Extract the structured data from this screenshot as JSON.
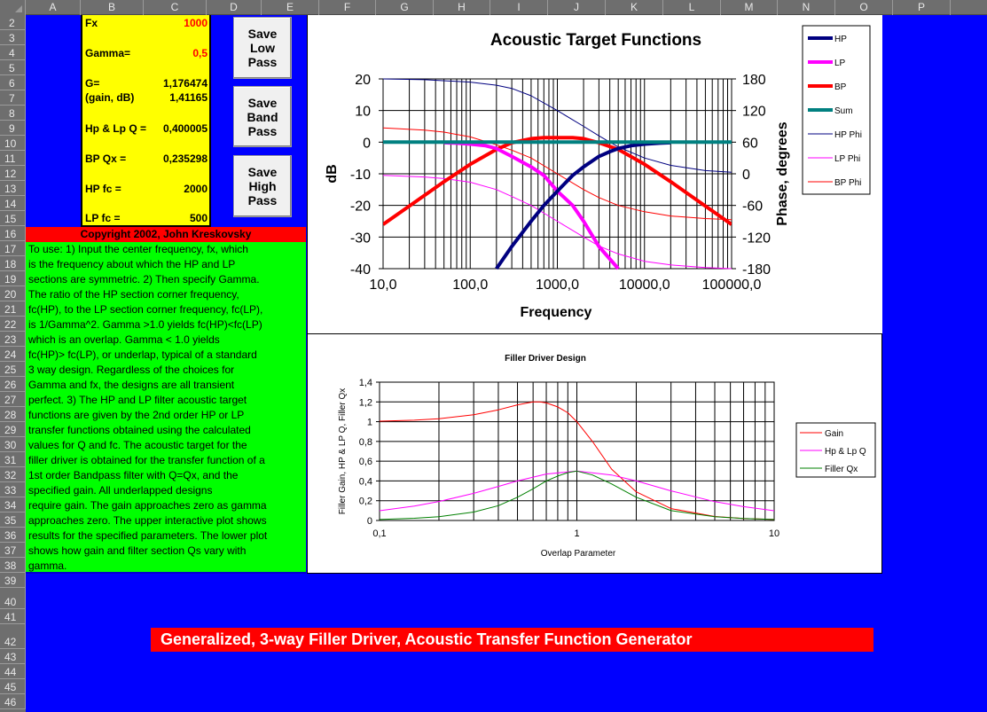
{
  "sheet": {
    "columns": [
      "A",
      "B",
      "C",
      "D",
      "E",
      "F",
      "G",
      "H",
      "I",
      "J",
      "K",
      "L",
      "M",
      "N",
      "O",
      "P"
    ],
    "rows": [
      "2",
      "3",
      "4",
      "5",
      "6",
      "7",
      "8",
      "9",
      "10",
      "11",
      "12",
      "13",
      "14",
      "15",
      "16",
      "17",
      "18",
      "19",
      "20",
      "21",
      "22",
      "23",
      "24",
      "25",
      "26",
      "27",
      "28",
      "29",
      "30",
      "31",
      "32",
      "33",
      "34",
      "35",
      "36",
      "37",
      "38",
      "39",
      "40",
      "41",
      "42",
      "43",
      "44",
      "45",
      "46"
    ]
  },
  "params": {
    "fx_label": "Fx",
    "fx_value": "1000",
    "gamma_label": "Gamma=",
    "gamma_value": "0,5",
    "g_label": "G=",
    "g_value": "1,176474",
    "gain_db_label": "(gain, dB)",
    "gain_db_value": "1,41165",
    "hplp_q_label": "Hp & Lp Q =",
    "hplp_q_value": "0,400005",
    "bp_qx_label": "BP Qx =",
    "bp_qx_value": "0,235298",
    "hp_fc_label": "HP fc =",
    "hp_fc_value": "2000",
    "lp_fc_label": "LP fc =",
    "lp_fc_value": "500"
  },
  "buttons": {
    "save_low_pass": "Save\nLow\nPass",
    "save_band_pass": "Save\nBand\nPass",
    "save_high_pass": "Save\nHigh\nPass"
  },
  "copyright": "Copyright 2002, John Kreskovsky",
  "instructions": [
    "To use: 1) Input the center frequency, fx, which",
    "is the frequency about which the HP and LP",
    "sections are symmetric. 2) Then specify Gamma.",
    "The ratio of the HP section corner frequency,",
    "fc(HP), to the LP section corner frequency, fc(LP),",
    "is 1/Gamma^2. Gamma >1.0 yields fc(HP)<fc(LP)",
    "which is an overlap. Gamma < 1.0 yields",
    "fc(HP)> fc(LP), or underlap, typical of a standard",
    "3 way design. Regardless of the choices for",
    "Gamma and fx, the designs are all transient",
    "perfect. 3) The HP and LP filter acoustic target",
    "functions are given by the 2nd order HP or LP",
    "transfer functions obtained using the calculated",
    "values for Q and fc. The acoustic target for the",
    "filler driver is obtained for the transfer function of a",
    "1st order Bandpass filter with Q=Qx, and the",
    "specified gain.  All underlapped designs",
    "require gain. The gain approaches zero as gamma",
    "approaches zero. The upper interactive plot shows",
    "results for the specified parameters. The lower plot",
    "shows how gain and filter section Qs vary with",
    "gamma."
  ],
  "banner": "Generalized, 3-way Filler Driver, Acoustic Transfer Function Generator",
  "chart_data": [
    {
      "type": "line",
      "title": "Acoustic Target Functions",
      "xlabel": "Frequency",
      "ylabel": "dB",
      "y2label": "Phase, degrees",
      "xscale": "log",
      "xlim": [
        10,
        100000
      ],
      "ylim": [
        -40,
        20
      ],
      "y2lim": [
        -180,
        180
      ],
      "xticks": [
        "10,0",
        "100,0",
        "1000,0",
        "10000,0",
        "100000,0"
      ],
      "yticks": [
        "20",
        "10",
        "0",
        "-10",
        "-20",
        "-30",
        "-40"
      ],
      "y2ticks": [
        "180",
        "120",
        "60",
        "0",
        "-60",
        "-120",
        "-180"
      ],
      "grid": true,
      "legend": "right",
      "params": {
        "fx": 1000,
        "hp_fc": 2000,
        "lp_fc": 500,
        "q": 0.400005,
        "qx": 0.235298,
        "gain": 1.176474
      },
      "series": [
        {
          "name": "HP",
          "color": "#000080",
          "width": "thick",
          "axis": "dB",
          "x": [
            200,
            300,
            500,
            700,
            1000,
            1500,
            2000,
            3000,
            4000,
            5000,
            7000,
            10000,
            15000,
            20000
          ],
          "y": [
            -40,
            -33,
            -25,
            -20,
            -15.5,
            -10.5,
            -7.8,
            -4.5,
            -3,
            -2,
            -1.1,
            -0.6,
            -0.3,
            -0.15
          ]
        },
        {
          "name": "LP",
          "color": "#ff00ff",
          "width": "thick",
          "axis": "dB",
          "x": [
            50,
            70,
            100,
            150,
            200,
            300,
            500,
            700,
            1000,
            1500,
            2000,
            3000,
            5000
          ],
          "y": [
            -0.15,
            -0.3,
            -0.6,
            -1.1,
            -2,
            -4.5,
            -7.8,
            -10.5,
            -15.5,
            -20,
            -25,
            -33,
            -40
          ]
        },
        {
          "name": "BP",
          "color": "#ff0000",
          "width": "thick",
          "axis": "dB",
          "x": [
            10,
            20,
            50,
            100,
            200,
            300,
            500,
            700,
            1000,
            1500,
            2000,
            3000,
            5000,
            10000,
            20000,
            50000,
            100000
          ],
          "y": [
            -26,
            -20.2,
            -12.5,
            -7,
            -2.3,
            -0.2,
            1.1,
            1.4,
            1.4,
            1.4,
            1.1,
            -0.2,
            -2.3,
            -7,
            -12.5,
            -20.2,
            -26
          ]
        },
        {
          "name": "Sum",
          "color": "#008080",
          "width": "thick",
          "axis": "dB",
          "x": [
            10,
            100000
          ],
          "y": [
            0,
            0
          ]
        },
        {
          "name": "HP Phi",
          "color": "#000080",
          "width": "thin",
          "axis": "phase",
          "x": [
            10,
            30,
            100,
            200,
            300,
            500,
            1000,
            2000,
            3000,
            4000,
            5000,
            10000,
            20000,
            50000,
            100000
          ],
          "y": [
            180,
            178.5,
            174,
            168,
            162,
            148,
            120,
            90,
            72,
            60,
            51,
            30,
            16,
            6,
            3
          ]
        },
        {
          "name": "LP Phi",
          "color": "#ff00ff",
          "width": "thin",
          "axis": "phase",
          "x": [
            10,
            30,
            50,
            100,
            200,
            300,
            500,
            1000,
            2000,
            3000,
            5000,
            10000,
            20000,
            50000,
            100000
          ],
          "y": [
            -3,
            -6,
            -9,
            -16,
            -30,
            -43,
            -60,
            -90,
            -120,
            -137,
            -152,
            -166,
            -173,
            -178,
            -180
          ]
        },
        {
          "name": "BP Phi",
          "color": "#ff0000",
          "width": "thin",
          "axis": "phase",
          "x": [
            10,
            30,
            50,
            100,
            200,
            300,
            500,
            1000,
            2000,
            3000,
            5000,
            10000,
            20000,
            50000,
            100000
          ],
          "y": [
            87,
            83,
            79,
            70,
            55,
            45,
            30,
            0,
            -30,
            -45,
            -60,
            -72,
            -80,
            -85,
            -87
          ]
        }
      ]
    },
    {
      "type": "line",
      "title": "Filler Driver Design",
      "xlabel": "Overlap Parameter",
      "ylabel": "Filler Gain, HP & LP Q, Filler Qx",
      "xscale": "log",
      "xlim": [
        0.1,
        10
      ],
      "ylim": [
        0,
        1.4
      ],
      "xticks": [
        "0,1",
        "1",
        "10"
      ],
      "yticks": [
        "1,4",
        "1,2",
        "1",
        "0,8",
        "0,6",
        "0,4",
        "0,2",
        "0"
      ],
      "grid": true,
      "legend": "right",
      "series": [
        {
          "name": "Gain",
          "color": "#ff0000",
          "x": [
            0.1,
            0.15,
            0.2,
            0.3,
            0.4,
            0.5,
            0.6,
            0.65,
            0.7,
            0.8,
            0.9,
            1,
            1.2,
            1.5,
            2,
            3,
            5,
            7,
            10
          ],
          "y": [
            1.005,
            1.015,
            1.03,
            1.07,
            1.12,
            1.17,
            1.2,
            1.2,
            1.19,
            1.15,
            1.09,
            1.0,
            0.8,
            0.52,
            0.29,
            0.12,
            0.04,
            0.02,
            0.01
          ]
        },
        {
          "name": "Hp & Lp Q",
          "color": "#ff00ff",
          "x": [
            0.1,
            0.15,
            0.2,
            0.3,
            0.4,
            0.5,
            0.7,
            1,
            1.5,
            2,
            3,
            5,
            7,
            10
          ],
          "y": [
            0.099,
            0.145,
            0.192,
            0.275,
            0.345,
            0.4,
            0.47,
            0.5,
            0.46,
            0.4,
            0.3,
            0.19,
            0.14,
            0.099
          ]
        },
        {
          "name": "Filler Qx",
          "color": "#008000",
          "x": [
            0.1,
            0.15,
            0.2,
            0.3,
            0.4,
            0.5,
            0.6,
            0.7,
            0.8,
            0.9,
            1,
            1.2,
            1.5,
            2,
            3,
            5,
            7,
            10
          ],
          "y": [
            0.01,
            0.022,
            0.038,
            0.085,
            0.15,
            0.235,
            0.32,
            0.4,
            0.45,
            0.485,
            0.5,
            0.46,
            0.37,
            0.235,
            0.1,
            0.038,
            0.02,
            0.01
          ]
        }
      ]
    }
  ]
}
